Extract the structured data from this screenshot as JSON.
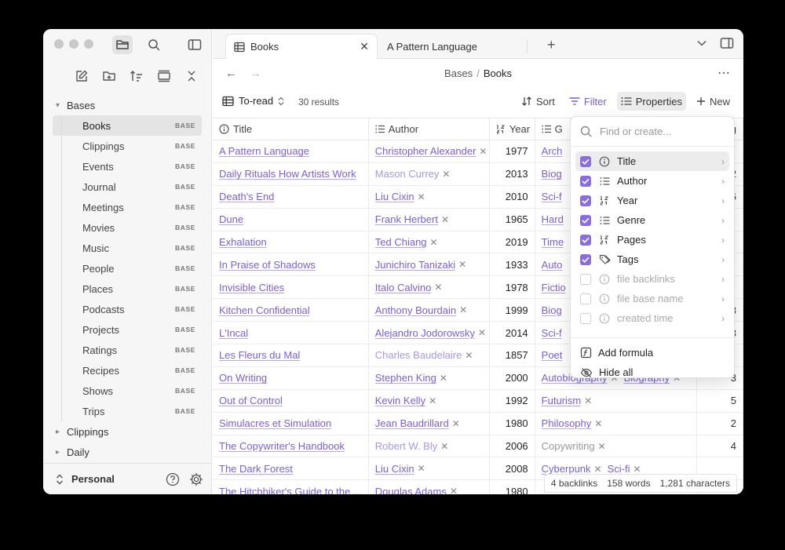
{
  "sidebar": {
    "groups": {
      "bases": "Bases",
      "clippings": "Clippings",
      "daily": "Daily"
    },
    "items": [
      {
        "label": "Books",
        "badge": "BASE"
      },
      {
        "label": "Clippings",
        "badge": "BASE"
      },
      {
        "label": "Events",
        "badge": "BASE"
      },
      {
        "label": "Journal",
        "badge": "BASE"
      },
      {
        "label": "Meetings",
        "badge": "BASE"
      },
      {
        "label": "Movies",
        "badge": "BASE"
      },
      {
        "label": "Music",
        "badge": "BASE"
      },
      {
        "label": "People",
        "badge": "BASE"
      },
      {
        "label": "Places",
        "badge": "BASE"
      },
      {
        "label": "Podcasts",
        "badge": "BASE"
      },
      {
        "label": "Projects",
        "badge": "BASE"
      },
      {
        "label": "Ratings",
        "badge": "BASE"
      },
      {
        "label": "Recipes",
        "badge": "BASE"
      },
      {
        "label": "Shows",
        "badge": "BASE"
      },
      {
        "label": "Trips",
        "badge": "BASE"
      }
    ],
    "vault": "Personal"
  },
  "tabs": {
    "active": "Books",
    "second": "A Pattern Language"
  },
  "breadcrumb": {
    "parent": "Bases",
    "sep": "/",
    "current": "Books"
  },
  "toolbar": {
    "view": "To-read",
    "results": "30 results",
    "sort": "Sort",
    "filter": "Filter",
    "properties": "Properties",
    "new": "New"
  },
  "columns": {
    "title": "Title",
    "author": "Author",
    "year": "Year",
    "genre": "G",
    "pages": "ag"
  },
  "rows": [
    {
      "title": "A Pattern Language",
      "author": "Christopher Alexander",
      "year": "1977",
      "genre": [
        "Arch"
      ],
      "pages": ""
    },
    {
      "title": "Daily Rituals How Artists Work",
      "author": "Mason Currey",
      "year": "2013",
      "genre": [
        "Biog"
      ],
      "pages": "2"
    },
    {
      "title": "Death's End",
      "author": "Liu Cixin",
      "year": "2010",
      "genre": [
        "Sci-f"
      ],
      "pages": "6"
    },
    {
      "title": "Dune",
      "author": "Frank Herbert",
      "year": "1965",
      "genre": [
        "Hard"
      ],
      "pages": ""
    },
    {
      "title": "Exhalation",
      "author": "Ted Chiang",
      "year": "2019",
      "genre": [
        "Time"
      ],
      "pages": ""
    },
    {
      "title": "In Praise of Shadows",
      "author": "Junichiro Tanizaki",
      "year": "1933",
      "genre": [
        "Auto"
      ],
      "pages": ""
    },
    {
      "title": "Invisible Cities",
      "author": "Italo Calvino",
      "year": "1978",
      "genre": [
        "Fictio"
      ],
      "pages": ""
    },
    {
      "title": "Kitchen Confidential",
      "author": "Anthony Bourdain",
      "year": "1999",
      "genre": [
        "Biog"
      ],
      "pages": "3"
    },
    {
      "title": "L'Incal",
      "author": "Alejandro Jodorowsky",
      "year": "2014",
      "genre": [
        "Sci-f"
      ],
      "pages": "3"
    },
    {
      "title": "Les Fleurs du Mal",
      "author": "Charles Baudelaire",
      "year": "1857",
      "genre": [
        "Poet"
      ],
      "pages": ""
    },
    {
      "title": "On Writing",
      "author": "Stephen King",
      "year": "2000",
      "genre": [
        "Autobiography",
        "Biography"
      ],
      "pages": "3"
    },
    {
      "title": "Out of Control",
      "author": "Kevin Kelly",
      "year": "1992",
      "genre": [
        "Futurism"
      ],
      "pages": "5"
    },
    {
      "title": "Simulacres et Simulation",
      "author": "Jean Baudrillard",
      "year": "1980",
      "genre": [
        "Philosophy"
      ],
      "pages": "2"
    },
    {
      "title": "The Copywriter's Handbook",
      "author": "Robert W. Bly",
      "year": "2006",
      "genre": [
        "Copywriting"
      ],
      "pages": "4"
    },
    {
      "title": "The Dark Forest",
      "author": "Liu Cixin",
      "year": "2008",
      "genre": [
        "Cyberpunk",
        "Sci-fi"
      ],
      "pages": ""
    },
    {
      "title": "The Hitchhiker's Guide to the ...",
      "author": "Douglas Adams",
      "year": "1980",
      "genre": [],
      "pages": ""
    }
  ],
  "popover": {
    "search_placeholder": "Find or create...",
    "items": [
      {
        "label": "Title",
        "checked": true,
        "icon": "info-icon"
      },
      {
        "label": "Author",
        "checked": true,
        "icon": "list-icon"
      },
      {
        "label": "Year",
        "checked": true,
        "icon": "number-icon"
      },
      {
        "label": "Genre",
        "checked": true,
        "icon": "list-icon"
      },
      {
        "label": "Pages",
        "checked": true,
        "icon": "number-icon"
      },
      {
        "label": "Tags",
        "checked": true,
        "icon": "tags-icon"
      },
      {
        "label": "file backlinks",
        "checked": false,
        "icon": "info-icon"
      },
      {
        "label": "file base name",
        "checked": false,
        "icon": "info-icon"
      },
      {
        "label": "created time",
        "checked": false,
        "icon": "info-icon"
      }
    ],
    "add_formula": "Add formula",
    "hide_all": "Hide all"
  },
  "status": {
    "backlinks": "4 backlinks",
    "words": "158 words",
    "characters": "1,281 characters"
  },
  "colors": {
    "accent": "#7c5ed6",
    "checkbox": "#8a6ee0"
  }
}
